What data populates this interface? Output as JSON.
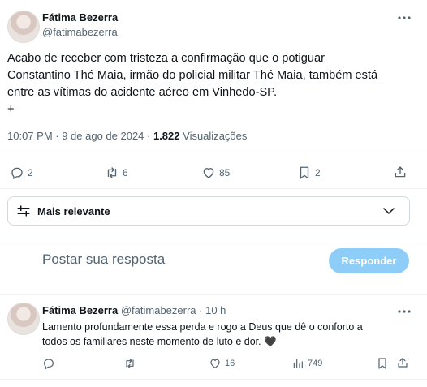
{
  "post": {
    "author_name": "Fátima Bezerra",
    "author_handle": "@fatimabezerra",
    "text_line1": "Acabo de receber com tristeza a confirmação que o potiguar",
    "text_line2": "Constantino Thé Maia, irmão do policial militar Thé Maia, também está",
    "text_line3": "entre as vítimas do acidente aéreo em Vinhedo-SP.",
    "text_line4": "+",
    "meta_time": "10:07 PM · 9 de ago de 2024 · ",
    "views_count": "1.822",
    "views_label": " Visualizações",
    "stats": {
      "replies": "2",
      "reposts": "6",
      "likes": "85",
      "bookmarks": "2"
    }
  },
  "sort": {
    "label": "Mais relevante"
  },
  "composer": {
    "placeholder": "Postar sua resposta",
    "reply_button": "Responder"
  },
  "reply": {
    "author_name": "Fátima Bezerra",
    "author_handle": "@fatimabezerra",
    "time": " · 10 h",
    "text_line1": "Lamento profundamente essa perda e rogo a Deus que dê o conforto a",
    "text_line2": "todos os familiares neste momento de luto e dor. 🖤",
    "stats": {
      "likes": "16",
      "views": "749"
    }
  },
  "icons": {
    "more": "more-dots-icon",
    "reply": "reply-bubble-icon",
    "repost": "repost-icon",
    "like": "heart-icon",
    "bookmark": "bookmark-icon",
    "share": "share-icon",
    "sort": "sort-sliders-icon",
    "chevron": "chevron-down-icon",
    "views": "views-bars-icon"
  },
  "colors": {
    "accent": "#1d9bf0",
    "reply_button_disabled": "#8ecdf8",
    "text": "#0f1419",
    "muted": "#536471"
  }
}
